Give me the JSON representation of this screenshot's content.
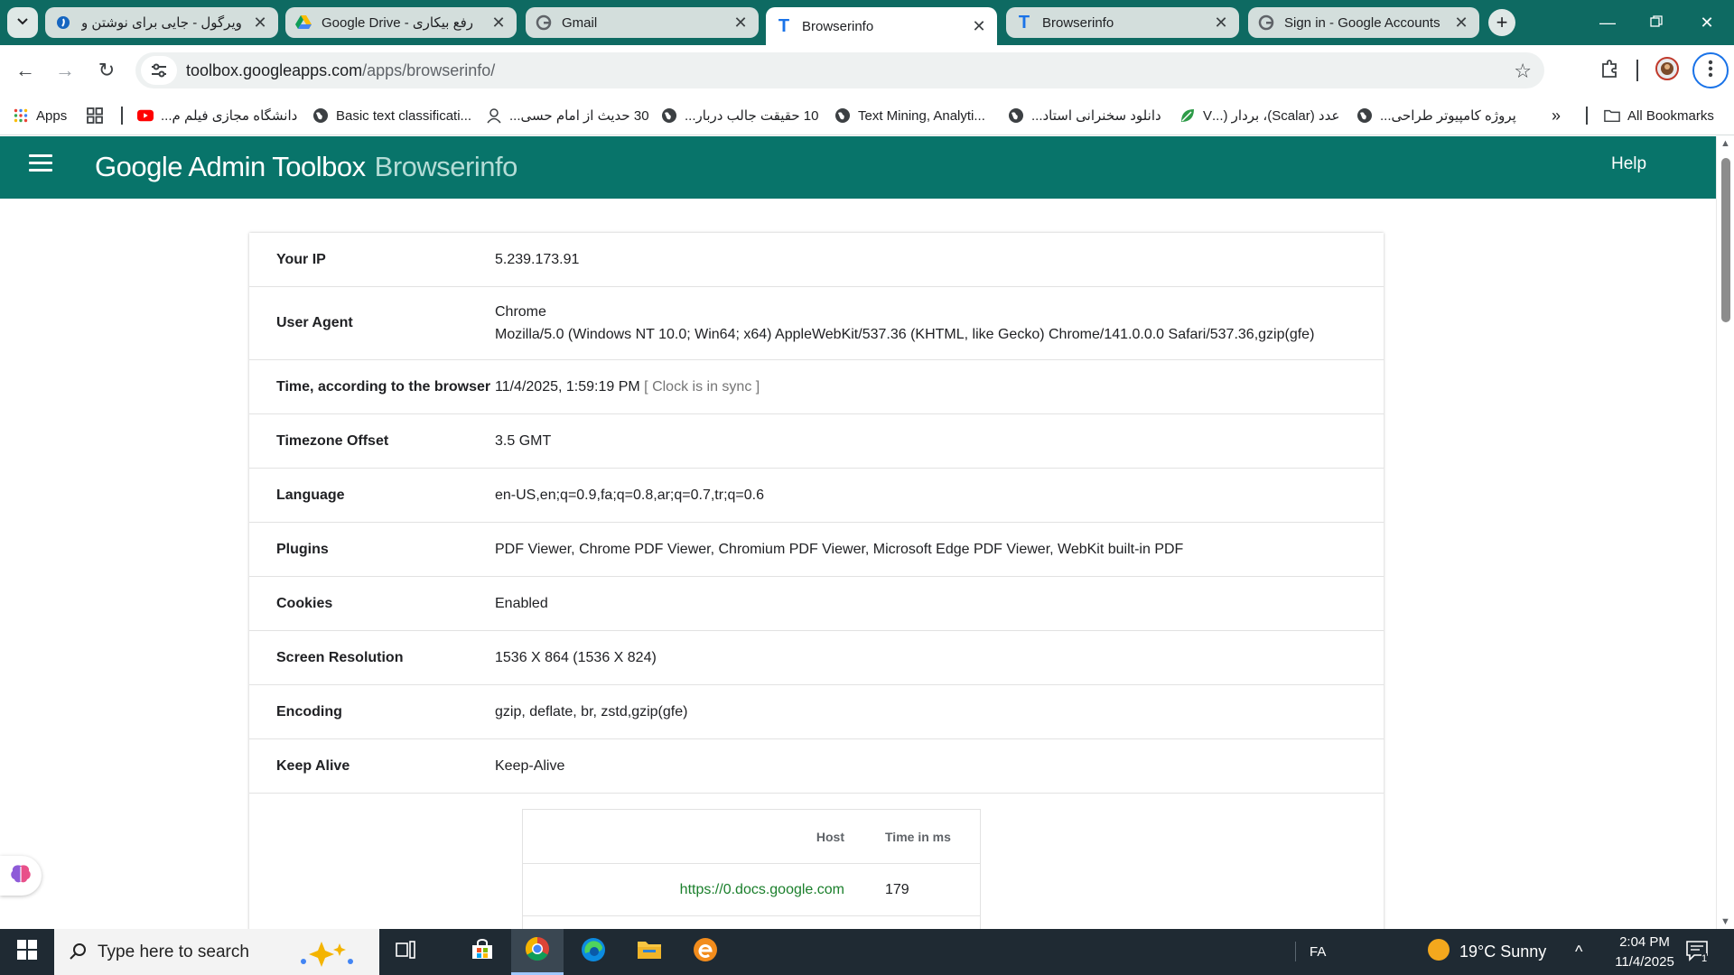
{
  "tabs": [
    {
      "title": "ویرگول - جایی برای نوشتن و",
      "icon": "virgool-icon",
      "rtl": true
    },
    {
      "title": "رفع بیکاری - Google Drive",
      "icon": "google-drive-icon",
      "rtl": true
    },
    {
      "title": "Gmail",
      "icon": "google-icon",
      "rtl": false
    },
    {
      "title": "Browserinfo",
      "icon": "toolbox-t-icon",
      "rtl": false,
      "active": true
    },
    {
      "title": "Browserinfo",
      "icon": "toolbox-t-icon",
      "rtl": false
    },
    {
      "title": "Sign in - Google Accounts",
      "icon": "google-icon",
      "rtl": false
    }
  ],
  "address_bar": {
    "host": "toolbox.googleapps.com",
    "path": "/apps/browserinfo/"
  },
  "bookmarks": {
    "apps_label": "Apps",
    "items": [
      "دانشگاه مجازی فیلم م...",
      "Basic text classificati...",
      "30 حدیث از امام حسی...",
      "10 حقیقت جالب دربار...",
      "Text Mining, Analyti...",
      "دانلود سخنرانی استاد...",
      "عدد (Scalar)، بردار (...V",
      "پروژه کامپیوتر طراحی..."
    ],
    "all_bookmarks_label": "All Bookmarks"
  },
  "header": {
    "brand": "Google Admin Toolbox",
    "app_name": "Browserinfo",
    "help_label": "Help"
  },
  "info": [
    {
      "label": "Your IP",
      "value": "5.239.173.91"
    },
    {
      "label": "User Agent",
      "value": "Chrome",
      "value2": "Mozilla/5.0 (Windows NT 10.0; Win64; x64) AppleWebKit/537.36 (KHTML, like Gecko) Chrome/141.0.0.0 Safari/537.36,gzip(gfe)"
    },
    {
      "label": "Time, according to the browser",
      "value": "11/4/2025, 1:59:19 PM",
      "note": "[ Clock is in sync ]"
    },
    {
      "label": "Timezone Offset",
      "value": "3.5 GMT"
    },
    {
      "label": "Language",
      "value": "en-US,en;q=0.9,fa;q=0.8,ar;q=0.7,tr;q=0.6"
    },
    {
      "label": "Plugins",
      "value": "PDF Viewer, Chrome PDF Viewer, Chromium PDF Viewer, Microsoft Edge PDF Viewer, WebKit built-in PDF"
    },
    {
      "label": "Cookies",
      "value": "Enabled"
    },
    {
      "label": "Screen Resolution",
      "value": "1536 X 864 (1536 X 824)"
    },
    {
      "label": "Encoding",
      "value": "gzip, deflate, br, zstd,gzip(gfe)"
    },
    {
      "label": "Keep Alive",
      "value": "Keep-Alive"
    }
  ],
  "hosts": {
    "col_host": "Host",
    "col_time": "Time in ms",
    "rows": [
      {
        "host": "https://0.docs.google.com",
        "time": "179"
      }
    ]
  },
  "taskbar": {
    "search_placeholder": "Type here to search",
    "lang": "FA",
    "weather": "19°C  Sunny",
    "time": "2:04 PM",
    "date": "11/4/2025",
    "notification_count": "1"
  },
  "colors": {
    "tabstrip": "#0e6a62",
    "header": "#08746a",
    "link_green": "#1a7f2b",
    "taskbar": "#1f2a33"
  }
}
